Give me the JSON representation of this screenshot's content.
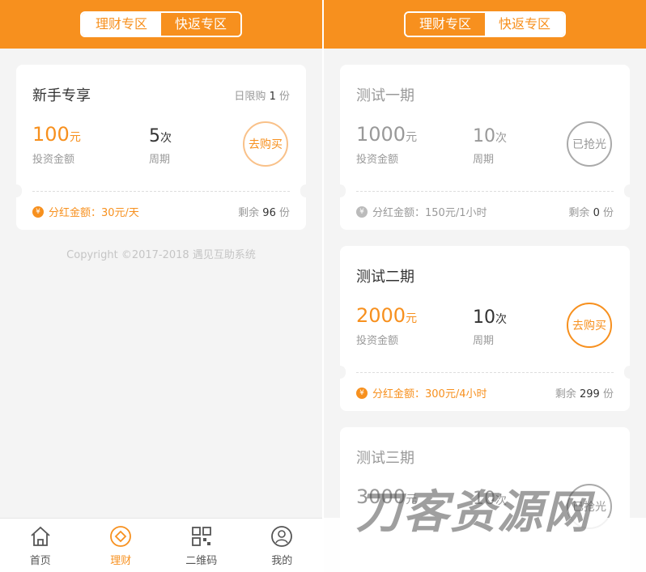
{
  "tabs": {
    "finance": "理财专区",
    "fast": "快返专区"
  },
  "left": {
    "card": {
      "title": "新手专享",
      "limit_prefix": "日限购",
      "limit_value": "1",
      "limit_suffix": "份",
      "amount": "100",
      "amount_unit": "元",
      "amount_label": "投资金额",
      "count": "5",
      "count_unit": "次",
      "count_label": "周期",
      "action": "去购买",
      "dividend": "分红金额：30元/天",
      "remain_prefix": "剩余",
      "remain_value": "96",
      "remain_suffix": "份"
    },
    "copyright": "Copyright ©2017-2018 遇见互助系统",
    "nav": [
      {
        "label": "首页",
        "icon": "home-icon"
      },
      {
        "label": "理财",
        "icon": "finance-icon"
      },
      {
        "label": "二维码",
        "icon": "qrcode-icon"
      },
      {
        "label": "我的",
        "icon": "user-icon"
      }
    ]
  },
  "right": {
    "cards": [
      {
        "title": "测试一期",
        "amount": "1000",
        "amount_unit": "元",
        "amount_label": "投资金额",
        "count": "10",
        "count_unit": "次",
        "count_label": "周期",
        "action": "已抢光",
        "dividend": "分红金额：150元/1小时",
        "remain_prefix": "剩余",
        "remain_value": "0",
        "remain_suffix": "份"
      },
      {
        "title": "测试二期",
        "amount": "2000",
        "amount_unit": "元",
        "amount_label": "投资金额",
        "count": "10",
        "count_unit": "次",
        "count_label": "周期",
        "action": "去购买",
        "dividend": "分红金额：300元/4小时",
        "remain_prefix": "剩余",
        "remain_value": "299",
        "remain_suffix": "份"
      },
      {
        "title": "测试三期",
        "amount": "3000",
        "amount_unit": "元",
        "count": "10",
        "count_unit": "次",
        "action": "已抢光"
      }
    ]
  },
  "watermark": "刀客资源网",
  "colors": {
    "accent": "#f7901e",
    "background": "#f4f4f4"
  }
}
